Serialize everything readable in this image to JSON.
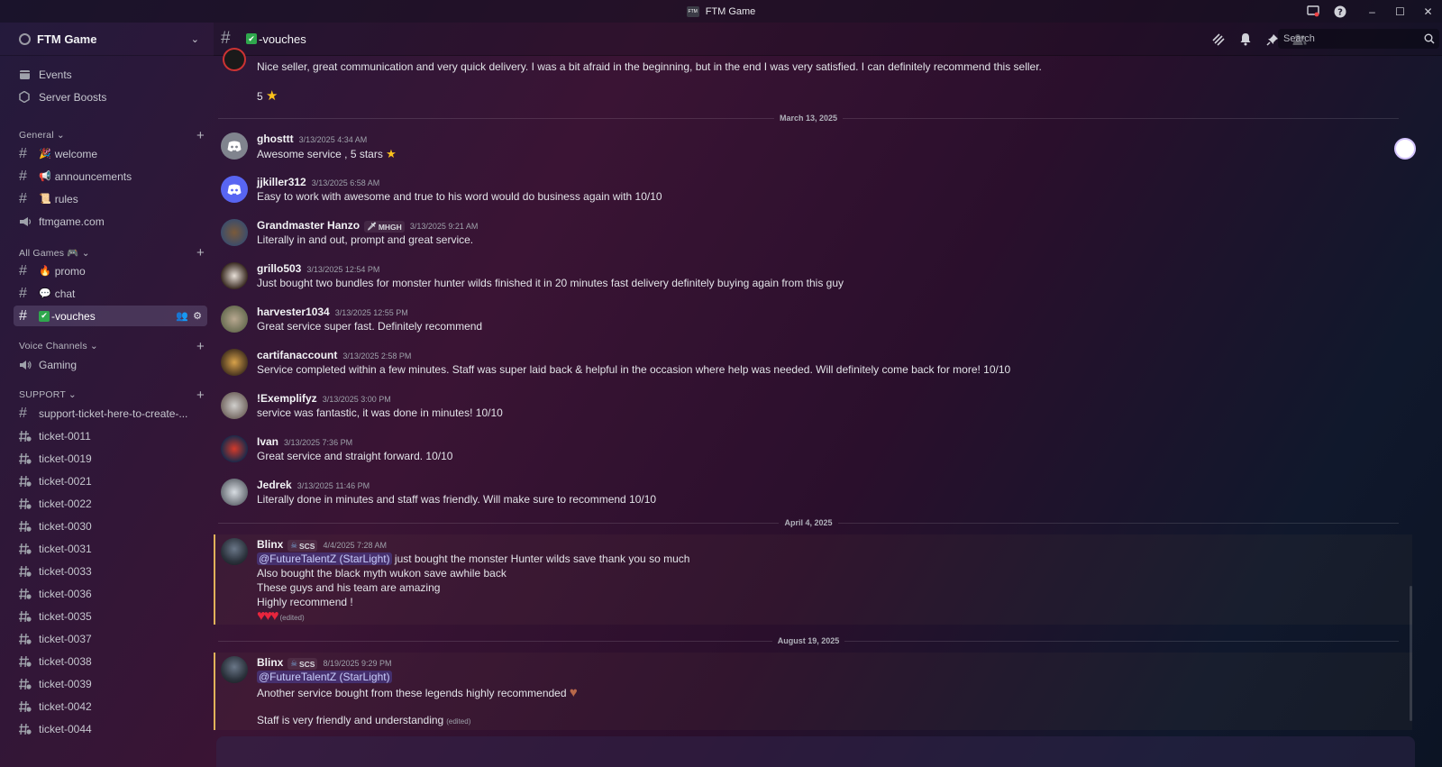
{
  "window": {
    "title": "FTM Game",
    "logo_text": "FTM"
  },
  "sidebar": {
    "server_name": "FTM Game",
    "top_items": [
      {
        "label": "Events",
        "icon": "calendar-icon"
      },
      {
        "label": "Server Boosts",
        "icon": "boost-icon"
      }
    ],
    "categories": {
      "general": "General",
      "all_games": "All Games",
      "voice": "Voice Channels",
      "support": "SUPPORT"
    },
    "channels": {
      "welcome": "welcome",
      "announcements": "announcements",
      "rules": "rules",
      "ftmgame": "ftmgame.com",
      "promo": "promo",
      "chat": "chat",
      "vouches": "-vouches",
      "gaming": "Gaming",
      "support_ticket": "support-ticket-here-to-create-..."
    },
    "tickets": [
      "ticket-0011",
      "ticket-0019",
      "ticket-0021",
      "ticket-0022",
      "ticket-0030",
      "ticket-0031",
      "ticket-0033",
      "ticket-0036",
      "ticket-0035",
      "ticket-0037",
      "ticket-0038",
      "ticket-0039",
      "ticket-0042",
      "ticket-0044"
    ]
  },
  "header": {
    "channel_name": "-vouches",
    "search_placeholder": "Search"
  },
  "messages": {
    "top": {
      "text": "Nice seller, great communication and very quick delivery. I was a bit afraid in the beginning, but in the end I was very satisfied. I can definitely recommend this seller.",
      "rating": "5"
    },
    "dates": {
      "mar13": "March 13, 2025",
      "apr4": "April 4, 2025",
      "aug19": "August 19, 2025"
    },
    "list": [
      {
        "user": "ghosttt",
        "time": "3/13/2025 4:34 AM",
        "text": "Awesome service , 5 stars"
      },
      {
        "user": "jjkiller312",
        "time": "3/13/2025 6:58 AM",
        "text": "Easy to work with awesome and true to his word would do business again with 10/10"
      },
      {
        "user": "Grandmaster Hanzo",
        "badge": "MHGH",
        "time": "3/13/2025 9:21 AM",
        "text": "Literally in and out, prompt and great service."
      },
      {
        "user": "grillo503",
        "time": "3/13/2025 12:54 PM",
        "text": "Just bought two bundles for monster hunter wilds finished it in 20 minutes fast delivery definitely buying again from this guy"
      },
      {
        "user": "harvester1034",
        "time": "3/13/2025 12:55 PM",
        "text": "Great service super fast. Definitely recommend"
      },
      {
        "user": "cartifanaccount",
        "time": "3/13/2025 2:58 PM",
        "text": "Service completed within a few minutes. Staff was super laid back & helpful in the occasion where help was needed. Will definitely come back for more! 10/10"
      },
      {
        "user": "!Exemplifyz",
        "time": "3/13/2025 3:00 PM",
        "text": "service was fantastic, it was done in minutes! 10/10"
      },
      {
        "user": "Ivan",
        "time": "3/13/2025 7:36 PM",
        "text": "Great service and straight forward. 10/10"
      },
      {
        "user": "Jedrek",
        "time": "3/13/2025 11:46 PM",
        "text": "Literally done in minutes and staff was friendly. Will make sure to recommend 10/10"
      }
    ],
    "blinx1": {
      "user": "Blinx",
      "badge": "SCS",
      "time": "4/4/2025 7:28 AM",
      "mention": "@FutureTalentZ (StarLight)",
      "line1": " just bought the monster Hunter wilds save thank you so much",
      "line2": "Also bought the black myth wukon save awhile back",
      "line3": "These guys and his team are amazing",
      "line4": "Highly recommend !",
      "edited": "(edited)"
    },
    "blinx2": {
      "user": "Blinx",
      "badge": "SCS",
      "time": "8/19/2025 9:29 PM",
      "mention": "@FutureTalentZ (StarLight)",
      "line2": "Another service bought from these legends highly recommended",
      "line3": "Staff is very friendly and understanding",
      "edited": "(edited)"
    }
  },
  "colors": {
    "accent": "#5865f2",
    "highlight_bar": "#e1b25a",
    "online_green": "#2fa74d"
  }
}
